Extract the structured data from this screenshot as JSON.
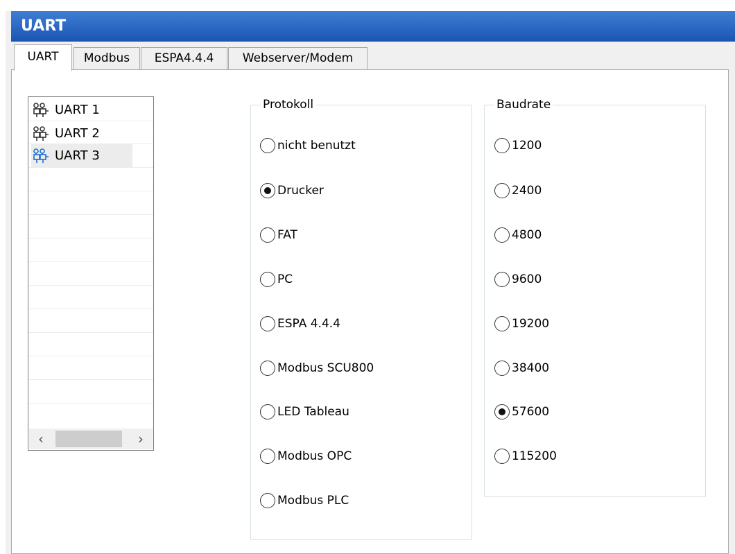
{
  "window": {
    "title": "UART"
  },
  "tabs": [
    {
      "label": "UART",
      "active": true
    },
    {
      "label": "Modbus",
      "active": false
    },
    {
      "label": "ESPA4.4.4",
      "active": false
    },
    {
      "label": "Webserver/Modem",
      "active": false
    }
  ],
  "uart_list": {
    "items": [
      {
        "label": "UART 1",
        "icon": "serial-port-icon",
        "selected": false
      },
      {
        "label": "UART 2",
        "icon": "serial-port-icon",
        "selected": false
      },
      {
        "label": "UART 3",
        "icon": "serial-port-icon",
        "selected": true
      }
    ],
    "scroll_left_glyph": "‹",
    "scroll_right_glyph": "›"
  },
  "protokoll": {
    "legend": "Protokoll",
    "options": [
      {
        "label": "nicht benutzt",
        "checked": false
      },
      {
        "label": "Drucker",
        "checked": true
      },
      {
        "label": "FAT",
        "checked": false
      },
      {
        "label": "PC",
        "checked": false
      },
      {
        "label": "ESPA 4.4.4",
        "checked": false
      },
      {
        "label": "Modbus SCU800",
        "checked": false
      },
      {
        "label": "LED Tableau",
        "checked": false
      },
      {
        "label": "Modbus OPC",
        "checked": false
      },
      {
        "label": "Modbus PLC",
        "checked": false
      }
    ]
  },
  "baudrate": {
    "legend": "Baudrate",
    "options": [
      {
        "label": "1200",
        "checked": false
      },
      {
        "label": "2400",
        "checked": false
      },
      {
        "label": "4800",
        "checked": false
      },
      {
        "label": "9600",
        "checked": false
      },
      {
        "label": "19200",
        "checked": false
      },
      {
        "label": "38400",
        "checked": false
      },
      {
        "label": "57600",
        "checked": true
      },
      {
        "label": "115200",
        "checked": false
      }
    ]
  },
  "colors": {
    "titlebar_top": "#3f7ed4",
    "titlebar_bottom": "#1a55b3",
    "selection": "#ececec",
    "icon_blue": "#1f6fd1"
  }
}
